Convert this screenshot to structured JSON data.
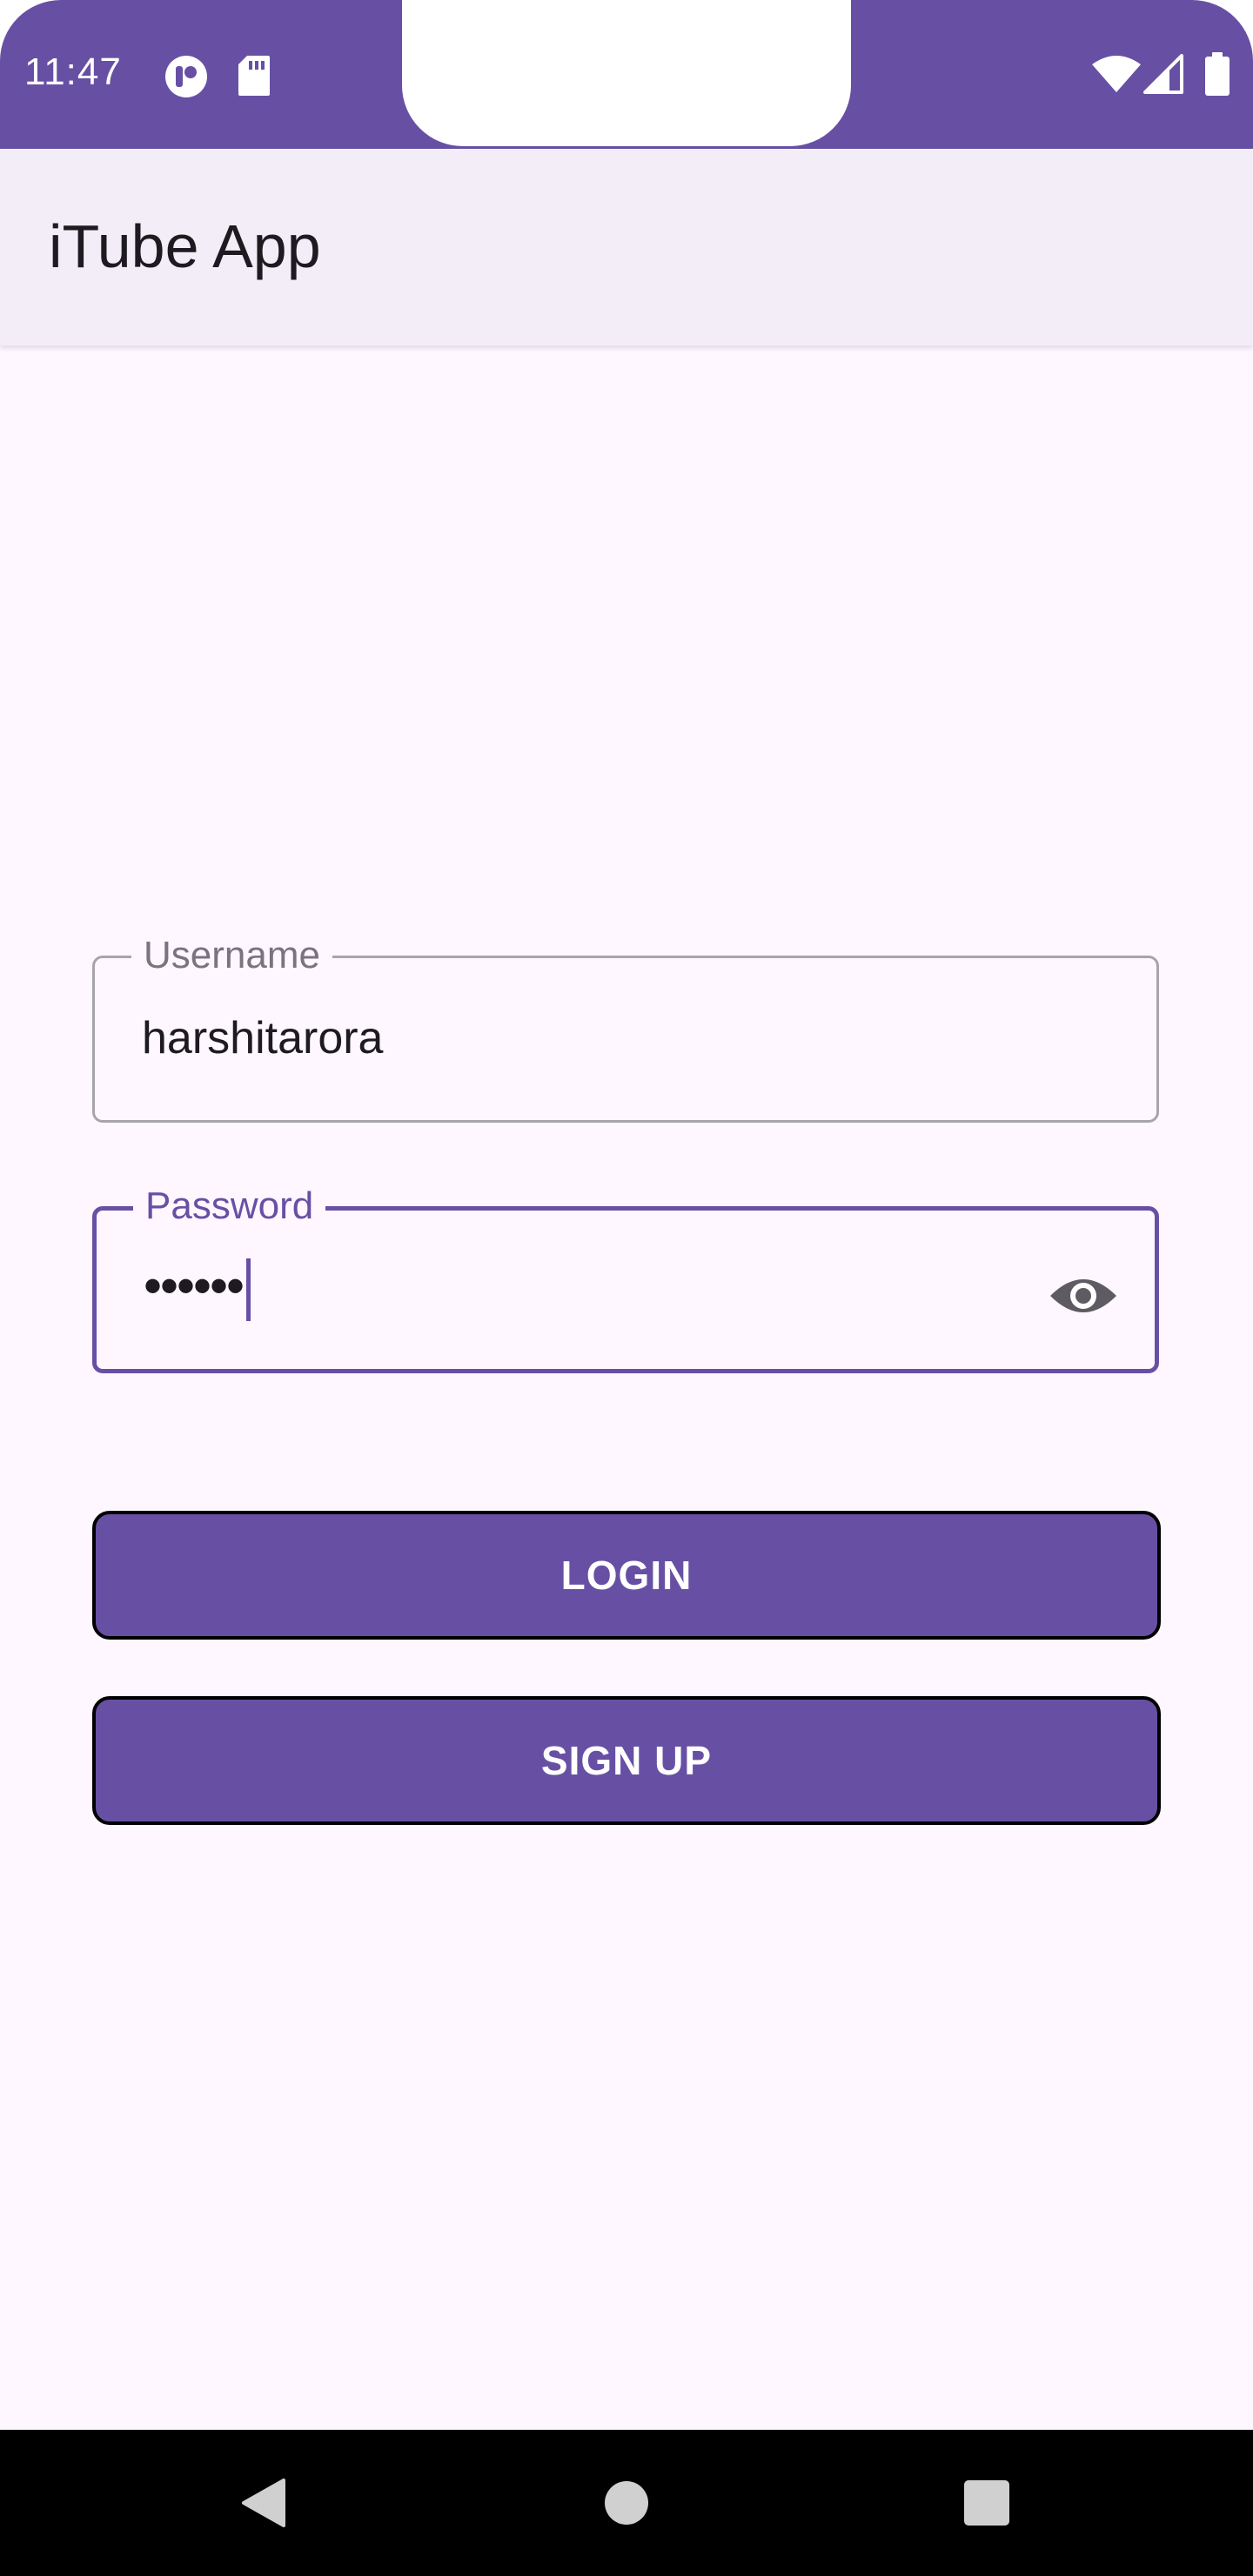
{
  "status_bar": {
    "time": "11:47",
    "icons": [
      "app-notification-icon",
      "sd-card-icon",
      "wifi-icon",
      "cell-signal-icon",
      "battery-icon"
    ]
  },
  "app_bar": {
    "title": "iTube App"
  },
  "login_form": {
    "username": {
      "label": "Username",
      "value": "harshitarora"
    },
    "password": {
      "label": "Password",
      "value": "••••••",
      "toggle_icon": "eye-icon"
    },
    "login_button": "LOGIN",
    "signup_button": "SIGN UP"
  },
  "nav_bar": {
    "icons": [
      "back-triangle-icon",
      "home-circle-icon",
      "recents-square-icon"
    ]
  },
  "colors": {
    "primary": "#6750A4",
    "background": "#FEF7FF",
    "app_bar": "#F3EDF7",
    "outline": "#A8A4AC",
    "text": "#1D1B20",
    "nav_bar": "#000000"
  }
}
